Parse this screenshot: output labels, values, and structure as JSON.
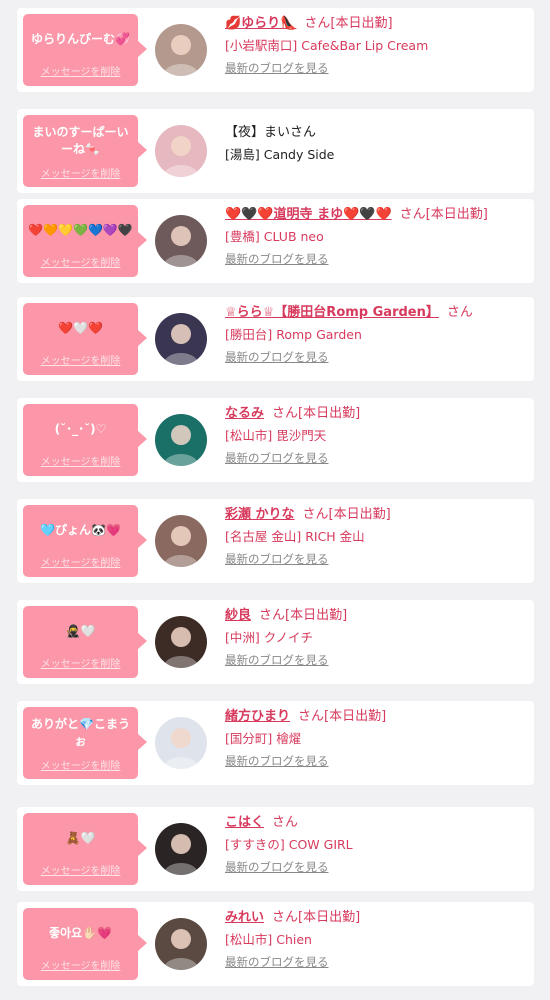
{
  "delete_label": "メッセージを削除",
  "blog_label": "最新のブログを見る",
  "colors": {
    "bubble": "#fb97a8",
    "accent": "#d73a5c",
    "background": "#f1f1f3"
  },
  "items": [
    {
      "message": "ゆらりんぴーむ💞",
      "name": "💋ゆらり👠",
      "suffix": "さん[本日出勤]",
      "shop": "[小岩駅南口] Cafe&Bar Lip Cream",
      "blog": true,
      "plain": false,
      "avatar_color": "#b49a8e"
    },
    {
      "message": "まいのすーぱーいーね🍬",
      "name": "【夜】まい",
      "suffix": "さん",
      "shop": "[湯島] Candy Side",
      "blog": false,
      "plain": true,
      "avatar_color": "#e6b8c0"
    },
    {
      "message": "❤️🧡💛💚💙💜🖤",
      "name": "❤️🖤❤️道明寺 まゆ❤️🖤❤️",
      "suffix": "さん[本日出勤]",
      "shop": "[豊橋] CLUB neo",
      "blog": true,
      "plain": false,
      "avatar_color": "#6e5a5a"
    },
    {
      "message": "❤️🤍❤️",
      "name": "♕らら♕【勝田台Romp Garden】",
      "suffix": "さん",
      "shop": "[勝田台] Romp Garden",
      "blog": true,
      "plain": false,
      "avatar_color": "#3a3550"
    },
    {
      "message": "(˘･_･˘)♡",
      "name": "なるみ",
      "suffix": "さん[本日出勤]",
      "shop": "[松山市] 毘沙門天",
      "blog": true,
      "plain": false,
      "avatar_color": "#1a6f66"
    },
    {
      "message": "🩵ぴょん🐼💗",
      "name": "彩瀬 かりな",
      "suffix": "さん[本日出勤]",
      "shop": "[名古屋 金山] RICH 金山",
      "blog": true,
      "plain": false,
      "avatar_color": "#8a6a60"
    },
    {
      "message": "🥷🤍",
      "name": "紗良",
      "suffix": "さん[本日出勤]",
      "shop": "[中洲] クノイチ",
      "blog": true,
      "plain": false,
      "avatar_color": "#3d2c26"
    },
    {
      "message": "ありがと💎こまうぉ",
      "name": "緒方ひまり",
      "suffix": "さん[本日出勤]",
      "shop": "[国分町] 檜燿",
      "blog": true,
      "plain": false,
      "avatar_color": "#dfe3ec"
    },
    {
      "message": "🧸🤍",
      "name": "こはく",
      "suffix": "さん",
      "shop": "[すすきの] COW GIRL",
      "blog": true,
      "plain": false,
      "avatar_color": "#2a2424"
    },
    {
      "message": "좋아요✋🏻💗",
      "name": "みれい",
      "suffix": "さん[本日出勤]",
      "shop": "[松山市] Chien",
      "blog": true,
      "plain": false,
      "avatar_color": "#5a4a42"
    }
  ]
}
